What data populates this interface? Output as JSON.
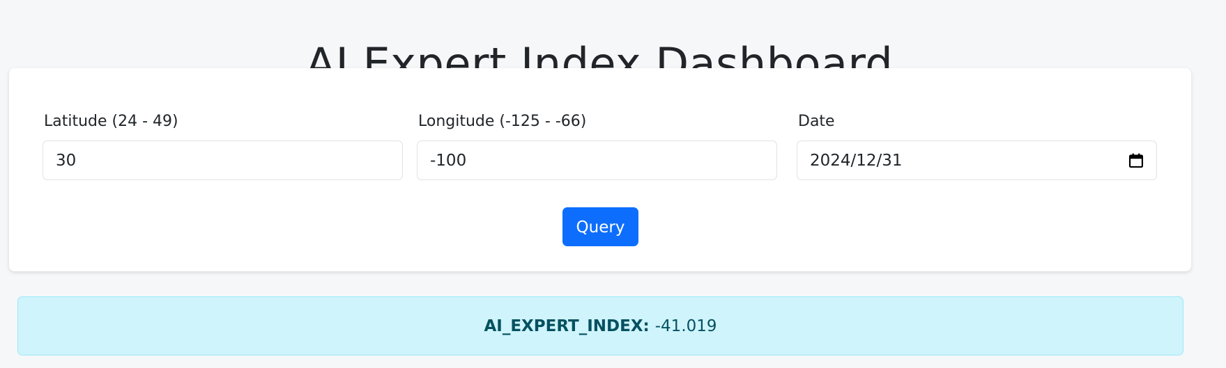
{
  "page": {
    "title": "AI Expert Index Dashboard"
  },
  "form": {
    "latitude": {
      "label": "Latitude (24 - 49)",
      "value": "30"
    },
    "longitude": {
      "label": "Longitude (-125 - -66)",
      "value": "-100"
    },
    "date": {
      "label": "Date",
      "value": "2024/12/31",
      "icon": "calendar-icon"
    },
    "query_button": "Query"
  },
  "result": {
    "label": "AI_EXPERT_INDEX:",
    "value": "-41.019"
  },
  "colors": {
    "primary": "#0d6efd",
    "alert_bg": "#cff4fc",
    "alert_text": "#055160",
    "page_bg": "#f6f7f8"
  }
}
